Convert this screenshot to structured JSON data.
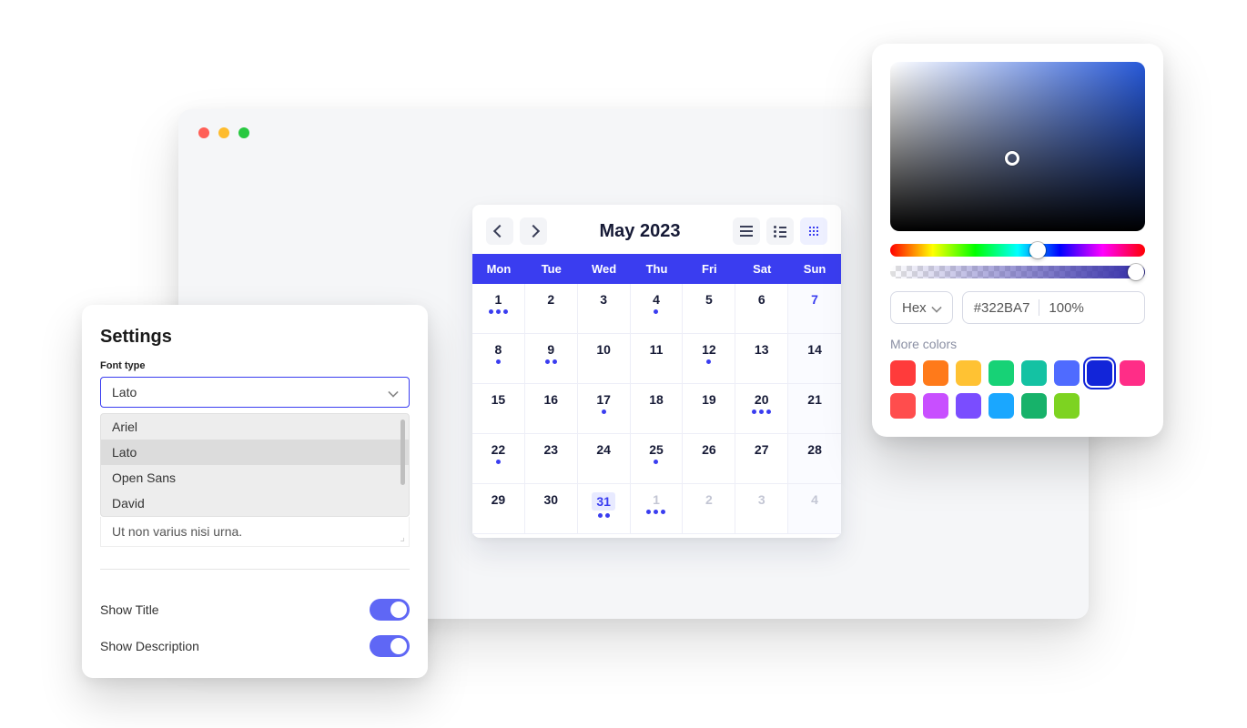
{
  "browser": {
    "traffic_colors": [
      "#ff5f57",
      "#febc2e",
      "#28c840"
    ]
  },
  "calendar": {
    "title": "May 2023",
    "days_of_week": [
      "Mon",
      "Tue",
      "Wed",
      "Thu",
      "Fri",
      "Sat",
      "Sun"
    ],
    "weeks": [
      [
        {
          "n": "1",
          "dots": 3
        },
        {
          "n": "2"
        },
        {
          "n": "3"
        },
        {
          "n": "4",
          "dots": 1
        },
        {
          "n": "5"
        },
        {
          "n": "6"
        },
        {
          "n": "7",
          "accent": true
        }
      ],
      [
        {
          "n": "8",
          "dots": 1
        },
        {
          "n": "9",
          "dots": 2
        },
        {
          "n": "10"
        },
        {
          "n": "11"
        },
        {
          "n": "12",
          "dots": 1
        },
        {
          "n": "13"
        },
        {
          "n": "14"
        }
      ],
      [
        {
          "n": "15"
        },
        {
          "n": "16"
        },
        {
          "n": "17",
          "dots": 1
        },
        {
          "n": "18"
        },
        {
          "n": "19"
        },
        {
          "n": "20",
          "dots": 3
        },
        {
          "n": "21"
        }
      ],
      [
        {
          "n": "22",
          "dots": 1
        },
        {
          "n": "23"
        },
        {
          "n": "24"
        },
        {
          "n": "25",
          "dots": 1
        },
        {
          "n": "26"
        },
        {
          "n": "27"
        },
        {
          "n": "28"
        }
      ],
      [
        {
          "n": "29"
        },
        {
          "n": "30"
        },
        {
          "n": "31",
          "sel": true,
          "dots": 2
        },
        {
          "n": "1",
          "faded": true,
          "dots": 3
        },
        {
          "n": "2",
          "faded": true
        },
        {
          "n": "3",
          "faded": true
        },
        {
          "n": "4",
          "faded": true
        }
      ]
    ]
  },
  "settings": {
    "title": "Settings",
    "font_type_label": "Font type",
    "selected_font": "Lato",
    "font_options": [
      "Ariel",
      "Lato",
      "Open Sans",
      "David"
    ],
    "highlighted_option_index": 1,
    "preview_text": "Ut non varius nisi urna.",
    "show_title_label": "Show Title",
    "show_title_on": true,
    "show_description_label": "Show Description",
    "show_description_on": true
  },
  "picker": {
    "format_label": "Hex",
    "hex_value": "#322BA7",
    "opacity_value": "100%",
    "more_colors_label": "More colors",
    "hue_thumb_pos": 0.58,
    "alpha_thumb_pos": 0.965,
    "swatches": [
      "#ff3b3b",
      "#ff7a1a",
      "#ffc233",
      "#17d276",
      "#14c2a3",
      "#4f6bff",
      "#1225d9",
      "#ff2d87",
      "#ff4d4d",
      "#c84fff",
      "#7a4dff",
      "#1aa7ff",
      "#17b26a",
      "#7dd321"
    ],
    "selected_swatch_index": 6
  }
}
